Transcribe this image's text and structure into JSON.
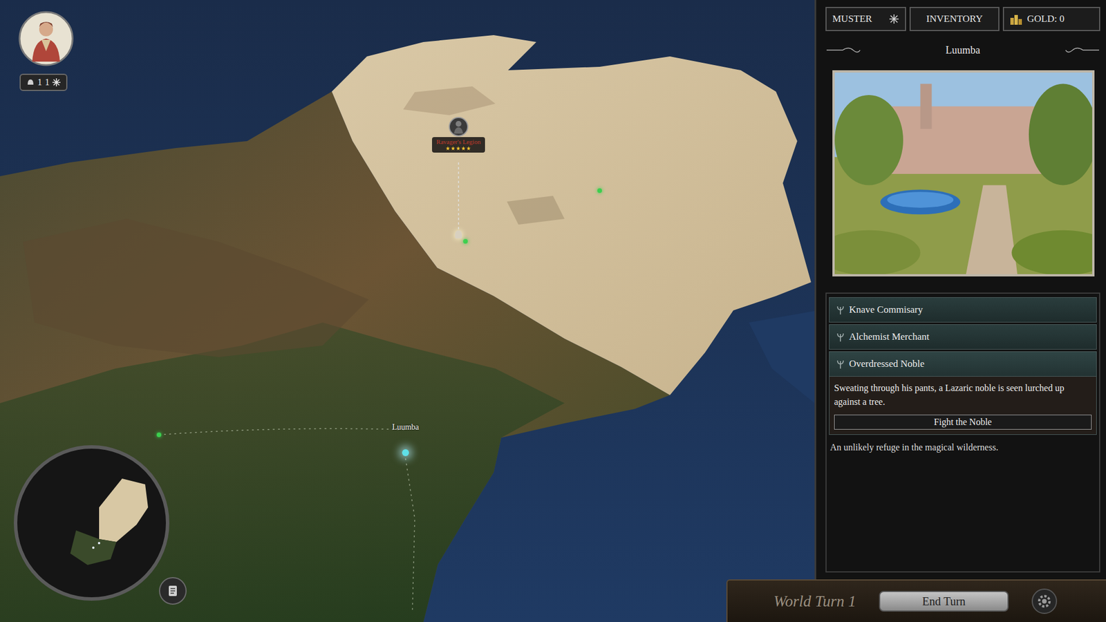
{
  "player": {
    "badge": [
      "1",
      "1"
    ]
  },
  "map": {
    "armies": [
      {
        "name": "Ravager's Legion",
        "stars": 5
      }
    ],
    "towns": [
      {
        "name": "Luumba"
      }
    ]
  },
  "topbar": {
    "muster": "MUSTER",
    "inventory": "INVENTORY",
    "gold": "GOLD: 0"
  },
  "location": {
    "title": "Luumba",
    "encounters": [
      {
        "name": "Knave Commisary",
        "expanded": false
      },
      {
        "name": "Alchemist Merchant",
        "expanded": false
      },
      {
        "name": "Overdressed Noble",
        "expanded": true,
        "text": "Sweating through his pants, a Lazaric noble is seen lurched up against a tree.",
        "action": "Fight the Noble"
      }
    ],
    "description": "An unlikely refuge in the magical wilderness."
  },
  "turn": {
    "label": "World Turn 1",
    "button": "End Turn"
  }
}
